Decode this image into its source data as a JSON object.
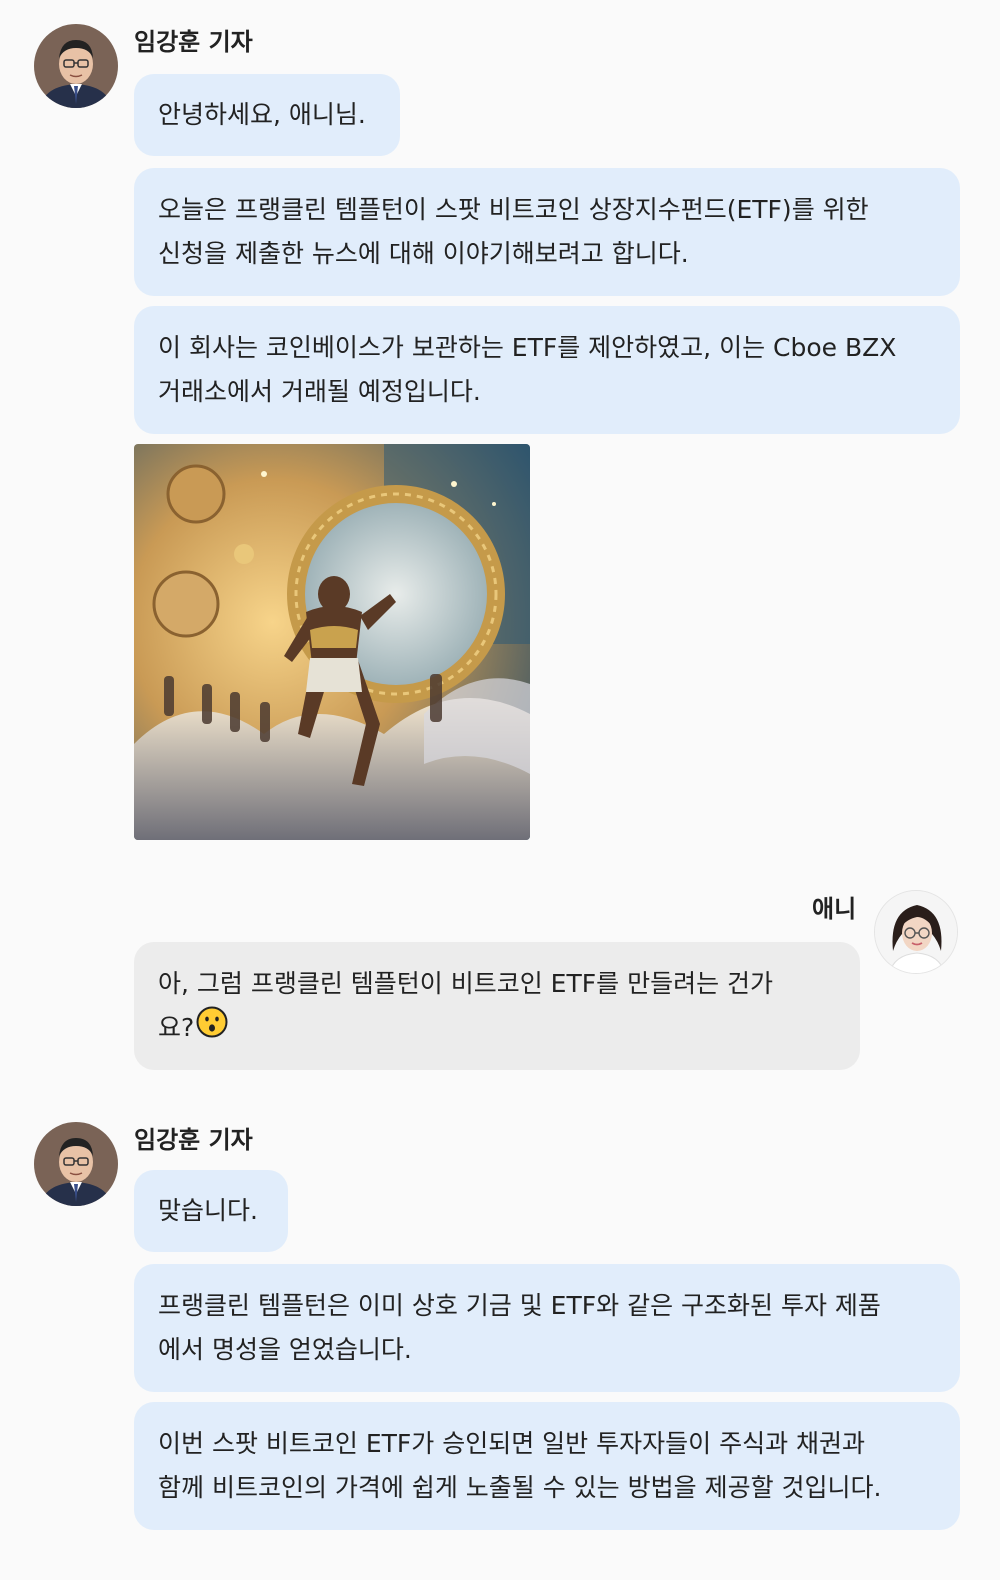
{
  "messages": {
    "m1": {
      "sender": "임강훈 기자",
      "avatar_icon": "reporter-avatar"
    },
    "b1": "안녕하세요, 애니님.",
    "b2": "오늘은 프랭클린 템플턴이 스팟 비트코인 상장지수펀드(ETF)를 위한\n신청을 제출한 뉴스에 대해 이야기해보려고 합니다.",
    "b3": "이 회사는 코인베이스가 보관하는 ETF를 제안하였고, 이는 Cboe BZX\n거래소에서 거래될 예정입니다.",
    "image_icon": "golden-runner-coin-illustration",
    "m2": {
      "sender": "애니",
      "avatar_icon": "anchor-avatar"
    },
    "b4": "아, 그럼 프랭클린 템플턴이 비트코인 ETF를 만들려는 건가\n요?",
    "b4_emoji": "surprised-face-icon",
    "m3": {
      "sender": "임강훈 기자",
      "avatar_icon": "reporter-avatar"
    },
    "b5": "맞습니다.",
    "b6": "프랭클린 템플턴은 이미 상호 기금 및 ETF와 같은 구조화된 투자 제품\n에서 명성을 얻었습니다.",
    "b7": "이번 스팟 비트코인 ETF가 승인되면 일반 투자자들이 주식과 채권과\n함께 비트코인의 가격에 쉽게 노출될 수 있는 방법을 제공할 것입니다."
  },
  "colors": {
    "bubble_left": "#e1edfb",
    "bubble_right": "#ececec",
    "background": "#fafafa"
  }
}
